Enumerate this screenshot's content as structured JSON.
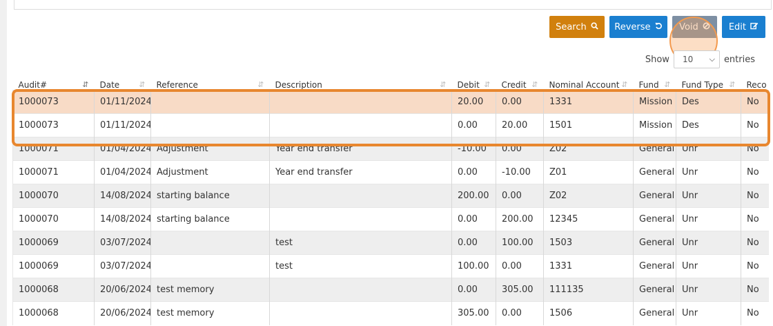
{
  "toolbar": {
    "search_label": "Search",
    "reverse_label": "Reverse",
    "void_label": "Void",
    "edit_label": "Edit"
  },
  "show": {
    "label_before": "Show",
    "value": "10",
    "label_after": "entries"
  },
  "table": {
    "headers": [
      "Audit#",
      "Date",
      "Reference",
      "Description",
      "Debit",
      "Credit",
      "Nominal Account",
      "Fund",
      "Fund Type",
      "Reco"
    ],
    "rows": [
      [
        "1000073",
        "01/11/2024",
        "",
        "",
        "20.00",
        "0.00",
        "1331",
        "Mission",
        "Des",
        "No"
      ],
      [
        "1000073",
        "01/11/2024",
        "",
        "",
        "0.00",
        "20.00",
        "1501",
        "Mission",
        "Des",
        "No"
      ],
      [
        "1000071",
        "01/04/2024",
        "Adjustment",
        "Year end transfer",
        "-10.00",
        "0.00",
        "Z02",
        "General",
        "Unr",
        "No"
      ],
      [
        "1000071",
        "01/04/2024",
        "Adjustment",
        "Year end transfer",
        "0.00",
        "-10.00",
        "Z01",
        "General",
        "Unr",
        "No"
      ],
      [
        "1000070",
        "14/08/2024",
        "starting balance",
        "",
        "200.00",
        "0.00",
        "Z02",
        "General",
        "Unr",
        "No"
      ],
      [
        "1000070",
        "14/08/2024",
        "starting balance",
        "",
        "0.00",
        "200.00",
        "12345",
        "General",
        "Unr",
        "No"
      ],
      [
        "1000069",
        "03/07/2024",
        "",
        "test",
        "0.00",
        "100.00",
        "1503",
        "General",
        "Unr",
        "No"
      ],
      [
        "1000069",
        "03/07/2024",
        "",
        "test",
        "100.00",
        "0.00",
        "1331",
        "General",
        "Unr",
        "No"
      ],
      [
        "1000068",
        "20/06/2024",
        "test memory",
        "",
        "0.00",
        "305.00",
        "111135",
        "General",
        "Unr",
        "No"
      ],
      [
        "1000068",
        "20/06/2024",
        "test memory",
        "",
        "305.00",
        "0.00",
        "1506",
        "General",
        "Unr",
        "No"
      ]
    ]
  },
  "colors": {
    "search": "#d1800d",
    "reverse": "#1a7fd0",
    "void": "#7d8fa3",
    "edit": "#1a7fd0",
    "highlight": "#e8872f",
    "selected_row": "#f8dbc6"
  },
  "icons": {
    "search": "search-icon",
    "reverse": "undo-icon",
    "void": "ban-icon",
    "edit": "edit-icon",
    "sort": "sort-icon",
    "dropdown": "chevron-down-icon"
  }
}
